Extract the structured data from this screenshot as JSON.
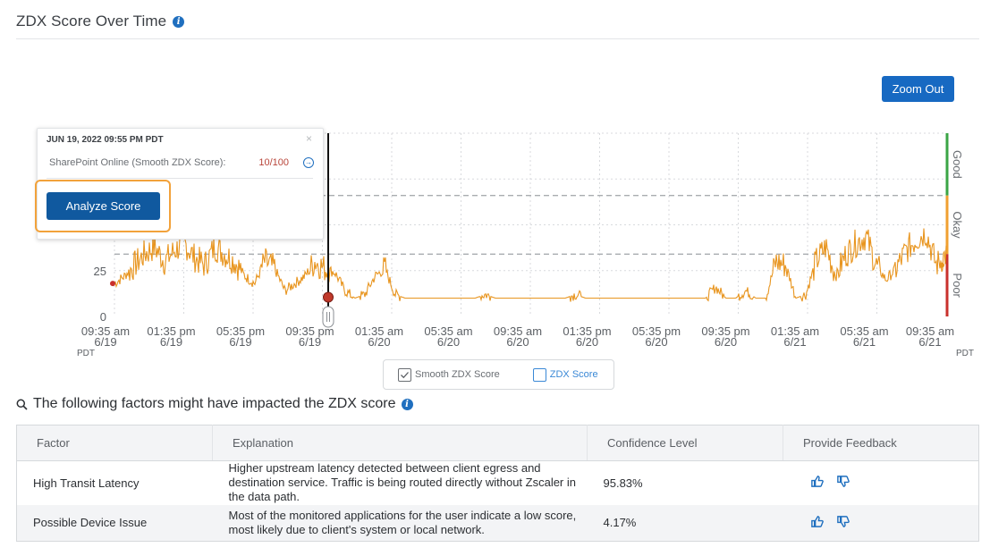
{
  "header": {
    "title": "ZDX Score Over Time",
    "zoom_out_label": "Zoom Out"
  },
  "tooltip": {
    "date": "JUN 19, 2022 09:55 PM PDT",
    "close": "×",
    "app_label": "SharePoint Online (Smooth ZDX Score):",
    "score": "10/100",
    "analyze_label": "Analyze Score"
  },
  "chart_data": {
    "type": "line",
    "title": "",
    "xlabel": "",
    "ylabel": "",
    "y_ticks": [
      "0",
      "25"
    ],
    "ylim": [
      0,
      100
    ],
    "zones": [
      "Good",
      "Okay",
      "Poor"
    ],
    "timezone_left": "PDT",
    "timezone_right": "PDT",
    "x_ticks": [
      {
        "time": "09:35 am",
        "date": "6/19"
      },
      {
        "time": "01:35 pm",
        "date": "6/19"
      },
      {
        "time": "05:35 pm",
        "date": "6/19"
      },
      {
        "time": "09:35 pm",
        "date": "6/19"
      },
      {
        "time": "01:35 am",
        "date": "6/20"
      },
      {
        "time": "05:35 am",
        "date": "6/20"
      },
      {
        "time": "09:35 am",
        "date": "6/20"
      },
      {
        "time": "01:35 pm",
        "date": "6/20"
      },
      {
        "time": "05:35 pm",
        "date": "6/20"
      },
      {
        "time": "09:35 pm",
        "date": "6/20"
      },
      {
        "time": "01:35 am",
        "date": "6/21"
      },
      {
        "time": "05:35 am",
        "date": "6/21"
      },
      {
        "time": "09:35 am",
        "date": "6/21"
      }
    ],
    "series": [
      {
        "name": "Smooth ZDX Score",
        "color": "#e8951f",
        "values_hourly": [
          18,
          22,
          28,
          34,
          38,
          30,
          36,
          40,
          32,
          28,
          38,
          34,
          30,
          22,
          18,
          30,
          26,
          14,
          18,
          22,
          30,
          26,
          24,
          14,
          10,
          12,
          22,
          26,
          12,
          10,
          10,
          10,
          10,
          10,
          10,
          10,
          10,
          12,
          10,
          10,
          10,
          10,
          10,
          10,
          10,
          10,
          12,
          10,
          10,
          10,
          10,
          10,
          10,
          10,
          10,
          10,
          10,
          10,
          10,
          10,
          16,
          10,
          10,
          14,
          10,
          10,
          30,
          28,
          10,
          12,
          30,
          38,
          22,
          34,
          40,
          44,
          28,
          20,
          26,
          36,
          42,
          46,
          28,
          34
        ]
      }
    ],
    "selected_point": {
      "label": "JUN 19, 2022 09:55 PM PDT",
      "value": 10
    }
  },
  "legend": {
    "smooth_label": "Smooth ZDX Score",
    "zdx_label": "ZDX Score"
  },
  "factors": {
    "title": "The following factors might have impacted the ZDX score",
    "columns": [
      "Factor",
      "Explanation",
      "Confidence Level",
      "Provide Feedback"
    ],
    "rows": [
      {
        "factor": "High Transit Latency",
        "explanation": "Higher upstream latency detected between client egress and destination service. Traffic is being routed directly without Zscaler in the data path.",
        "confidence": "95.83%"
      },
      {
        "factor": "Possible Device Issue",
        "explanation": "Most of the monitored applications for the user indicate a low score, most likely due to client's system or local network.",
        "confidence": "4.17%"
      }
    ]
  },
  "colors": {
    "accent": "#1769c2",
    "good": "#3aa545",
    "okay": "#f0a030",
    "poor": "#c9302c",
    "highlight": "#f2a23b"
  }
}
